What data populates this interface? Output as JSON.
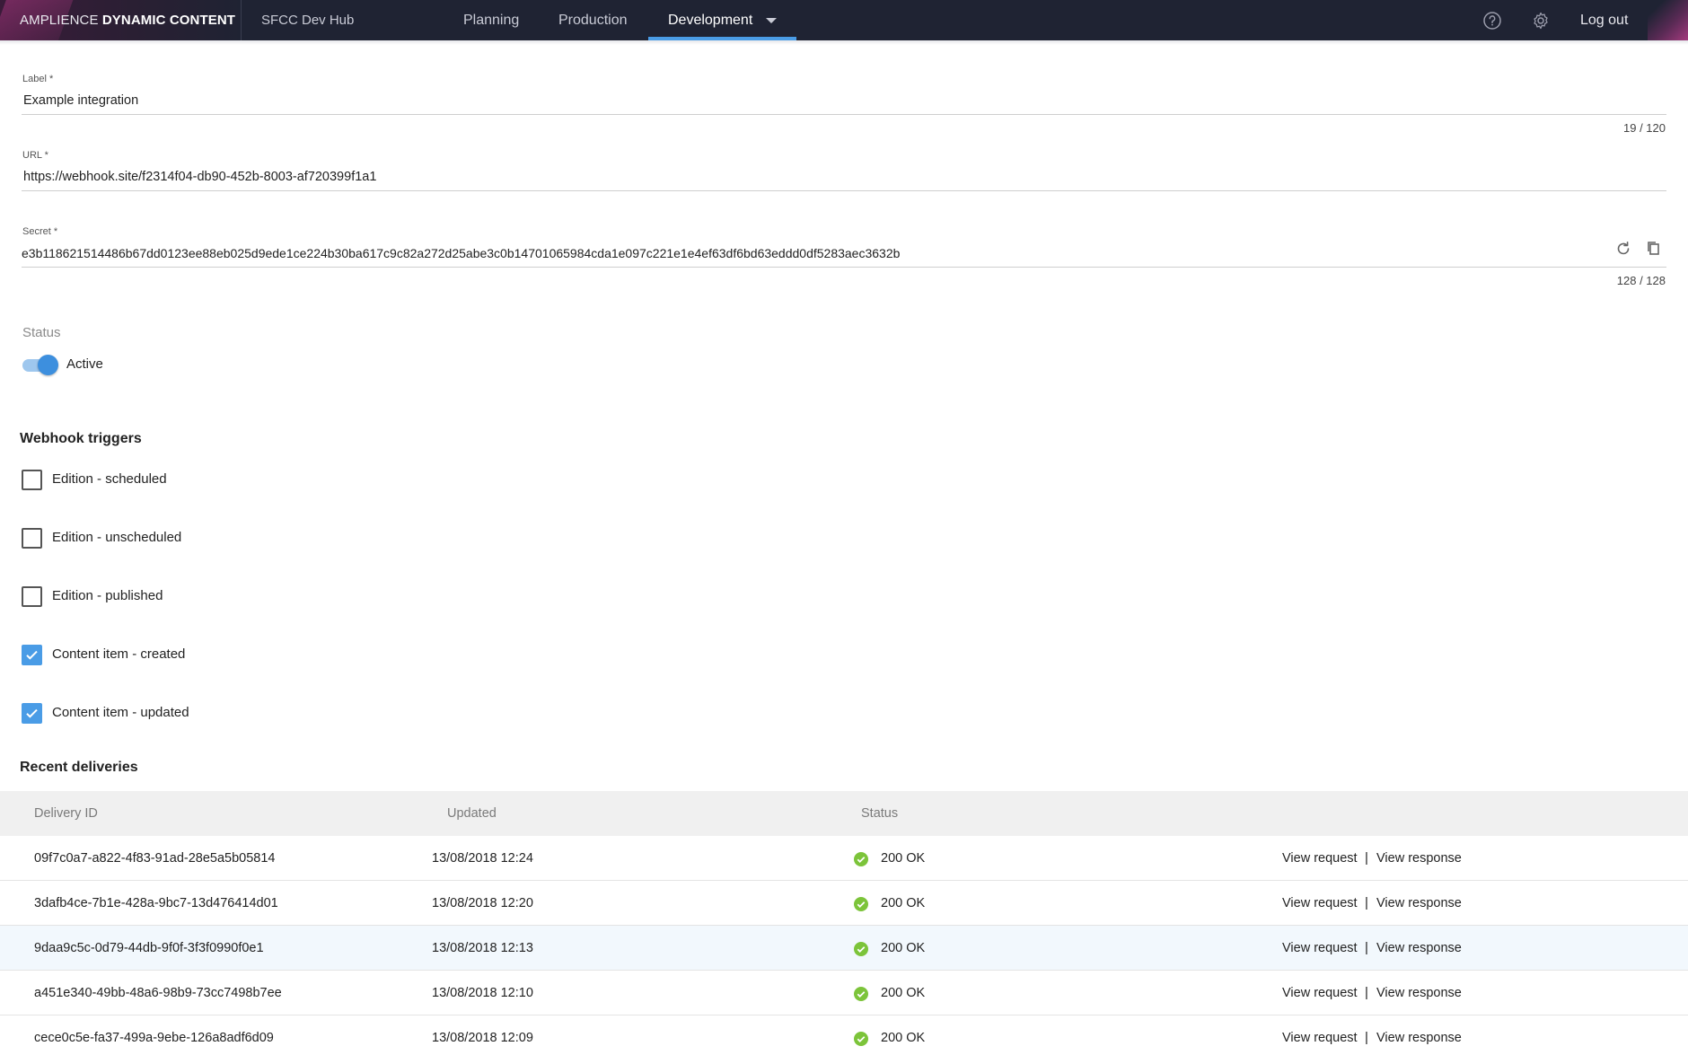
{
  "topbar": {
    "brand_light": "AMPLIENCE ",
    "brand_bold": "DYNAMIC CONTENT",
    "hub_name": "SFCC Dev Hub",
    "tabs": [
      {
        "label": "Planning"
      },
      {
        "label": "Production"
      },
      {
        "label": "Development"
      }
    ],
    "active_tab": "Development",
    "help_icon": "help-circle-icon",
    "settings_icon": "gear-icon",
    "logout_label": "Log out",
    "accent_color": "#4a9ce6"
  },
  "form": {
    "label": {
      "caption": "Label *",
      "value": "Example integration",
      "counter": "19 / 120"
    },
    "url": {
      "caption": "URL *",
      "value": "https://webhook.site/f2314f04-db90-452b-8003-af720399f1a1"
    },
    "secret": {
      "caption": "Secret *",
      "value": "e3b118621514486b67dd0123ee88eb025d9ede1ce224b30ba617c9c82a272d25abe3c0b14701065984cda1e097c221e1e4ef63df6bd63eddd0df5283aec3632b",
      "counter": "128 / 128",
      "regenerate_icon": "refresh-icon",
      "copy_icon": "copy-icon"
    },
    "status": {
      "caption": "Status",
      "toggle_label": "Active",
      "on": true
    }
  },
  "triggers": {
    "title": "Webhook triggers",
    "items": [
      {
        "label": "Edition - scheduled",
        "checked": false
      },
      {
        "label": "Edition - unscheduled",
        "checked": false
      },
      {
        "label": "Edition - published",
        "checked": false
      },
      {
        "label": "Content item - created",
        "checked": true
      },
      {
        "label": "Content item - updated",
        "checked": true
      }
    ]
  },
  "deliveries": {
    "title": "Recent deliveries",
    "columns": [
      "Delivery ID",
      "Updated",
      "Status"
    ],
    "view_request_label": "View request",
    "view_response_label": "View response",
    "separator": "|",
    "status_color": "#7cc43a",
    "rows": [
      {
        "id": "09f7c0a7-a822-4f83-91ad-28e5a5b05814",
        "updated": "13/08/2018 12:24",
        "status": "200 OK"
      },
      {
        "id": "3dafb4ce-7b1e-428a-9bc7-13d476414d01",
        "updated": "13/08/2018 12:20",
        "status": "200 OK"
      },
      {
        "id": "9daa9c5c-0d79-44db-9f0f-3f3f0990f0e1",
        "updated": "13/08/2018 12:13",
        "status": "200 OK"
      },
      {
        "id": "a451e340-49bb-48a6-98b9-73cc7498b7ee",
        "updated": "13/08/2018 12:10",
        "status": "200 OK"
      },
      {
        "id": "cece0c5e-fa37-499a-9ebe-126a8adf6d09",
        "updated": "13/08/2018 12:09",
        "status": "200 OK"
      }
    ]
  }
}
